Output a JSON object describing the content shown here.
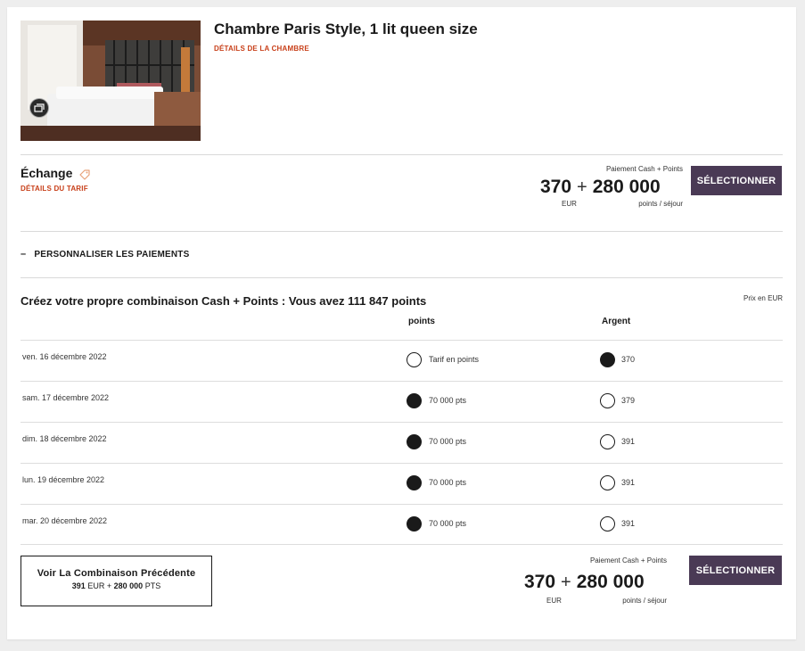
{
  "room": {
    "title": "Chambre Paris Style, 1 lit queen size",
    "details_link": "DÉTAILS DE LA CHAMBRE"
  },
  "rate": {
    "name": "Échange",
    "details_link": "DÉTAILS DU TARIF",
    "payment_caption": "Paiement Cash + Points",
    "cash": "370",
    "plus": "+",
    "points": "280 000",
    "cash_unit": "EUR",
    "points_unit": "points / séjour",
    "select_label": "SÉLECTIONNER"
  },
  "personalize": {
    "toggle": "–",
    "label": "PERSONNALISER LES PAIEMENTS"
  },
  "combination": {
    "title": "Créez votre propre combinaison Cash + Points : Vous avez 111 847 points",
    "currency_note": "Prix en EUR",
    "col_points": "points",
    "col_money": "Argent",
    "rows": [
      {
        "date": "ven. 16 décembre 2022",
        "points_label": "Tarif en points",
        "money_label": "370",
        "selected": "money"
      },
      {
        "date": "sam. 17 décembre 2022",
        "points_label": "70 000 pts",
        "money_label": "379",
        "selected": "points"
      },
      {
        "date": "dim. 18 décembre 2022",
        "points_label": "70 000 pts",
        "money_label": "391",
        "selected": "points"
      },
      {
        "date": "lun. 19 décembre 2022",
        "points_label": "70 000 pts",
        "money_label": "391",
        "selected": "points"
      },
      {
        "date": "mar. 20 décembre 2022",
        "points_label": "70 000 pts",
        "money_label": "391",
        "selected": "points"
      }
    ]
  },
  "previous": {
    "title": "Voir La Combinaison Précédente",
    "cash": "391",
    "cash_unit": "EUR",
    "plus": "+",
    "points": "280 000",
    "points_unit": "PTS"
  },
  "summary": {
    "payment_caption": "Paiement Cash + Points",
    "cash": "370",
    "plus": "+",
    "points": "280 000",
    "cash_unit": "EUR",
    "points_unit": "points / séjour",
    "select_label": "SÉLECTIONNER"
  },
  "icons": {
    "gallery": "gallery-icon",
    "tag": "tag-icon",
    "radio_on": "radio-selected",
    "radio_off": "radio-unselected"
  },
  "colors": {
    "accent_link": "#c8401a",
    "button": "#4a3a55",
    "radio_on": "#1a1a1a"
  }
}
